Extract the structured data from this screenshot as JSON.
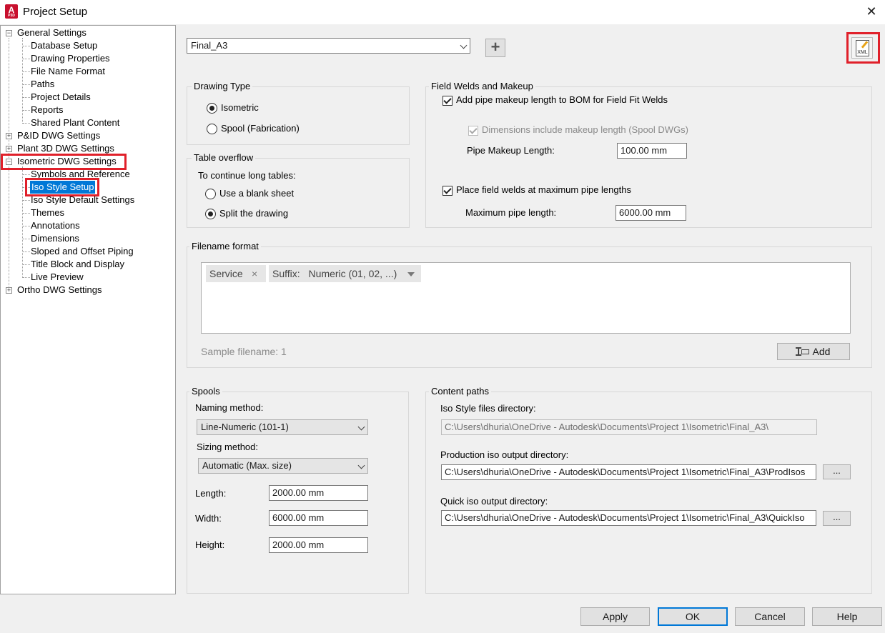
{
  "window": {
    "title": "Project Setup",
    "close_glyph": "✕",
    "app_icon_letter": "A",
    "app_icon_sub": "P3D"
  },
  "tree": {
    "general": "General Settings",
    "general_children": [
      "Database Setup",
      "Drawing Properties",
      "File Name Format",
      "Paths",
      "Project Details",
      "Reports",
      "Shared Plant Content"
    ],
    "pid": "P&ID DWG Settings",
    "plant3d": "Plant 3D DWG Settings",
    "isometric": "Isometric DWG Settings",
    "isometric_children": [
      "Symbols and Reference",
      "Iso Style Setup",
      "Iso Style Default Settings",
      "Themes",
      "Annotations",
      "Dimensions",
      "Sloped and Offset Piping",
      "Title Block and Display",
      "Live Preview"
    ],
    "ortho": "Ortho DWG Settings",
    "selected": "Iso Style Setup",
    "collapsed_glyph": "+",
    "expanded_glyph": "−"
  },
  "style_selector": {
    "value": "Final_A3",
    "add_glyph": "+"
  },
  "xml_button": {
    "label": "XML"
  },
  "drawing_type": {
    "title": "Drawing Type",
    "options": [
      "Isometric",
      "Spool (Fabrication)"
    ],
    "selected": "Isometric"
  },
  "table_overflow": {
    "title": "Table overflow",
    "prompt": "To continue long tables:",
    "options": [
      "Use a blank sheet",
      "Split the drawing"
    ],
    "selected": "Split the drawing"
  },
  "field_welds": {
    "title": "Field Welds and Makeup",
    "add_makeup": {
      "label": "Add pipe makeup length to BOM for Field Fit Welds",
      "checked": true
    },
    "dims_include": {
      "label": "Dimensions include makeup length (Spool DWGs)",
      "checked": true,
      "enabled": false
    },
    "makeup_length_label": "Pipe Makeup Length:",
    "makeup_length_value": "100.00 mm",
    "place_welds": {
      "label": "Place field welds at maximum pipe lengths",
      "checked": true
    },
    "max_length_label": "Maximum pipe length:",
    "max_length_value": "6000.00 mm"
  },
  "filename_format": {
    "title": "Filename format",
    "tokens": [
      {
        "label": "Service",
        "remove": "×"
      },
      {
        "label": "Suffix:",
        "value": "Numeric (01, 02, ...)"
      }
    ],
    "sample": "Sample filename: 1",
    "add_label": "Add"
  },
  "spools": {
    "title": "Spools",
    "naming_label": "Naming method:",
    "naming_value": "Line-Numeric (101-1)",
    "sizing_label": "Sizing method:",
    "sizing_value": "Automatic (Max. size)",
    "length_label": "Length:",
    "length_value": "2000.00 mm",
    "width_label": "Width:",
    "width_value": "6000.00 mm",
    "height_label": "Height:",
    "height_value": "2000.00 mm"
  },
  "content_paths": {
    "title": "Content paths",
    "iso_style_label": "Iso Style files directory:",
    "iso_style_value": "C:\\Users\\dhuria\\OneDrive - Autodesk\\Documents\\Project 1\\Isometric\\Final_A3\\",
    "production_label": "Production iso output directory:",
    "production_value": "C:\\Users\\dhuria\\OneDrive - Autodesk\\Documents\\Project 1\\Isometric\\Final_A3\\ProdIsos",
    "quick_label": "Quick iso output directory:",
    "quick_value": "C:\\Users\\dhuria\\OneDrive - Autodesk\\Documents\\Project 1\\Isometric\\Final_A3\\QuickIso",
    "browse_label": "..."
  },
  "footer": {
    "apply": "Apply",
    "ok": "OK",
    "cancel": "Cancel",
    "help": "Help"
  },
  "colors": {
    "selection": "#0078d7",
    "highlight_box": "#e0202a",
    "app_icon": "#c8102e"
  }
}
